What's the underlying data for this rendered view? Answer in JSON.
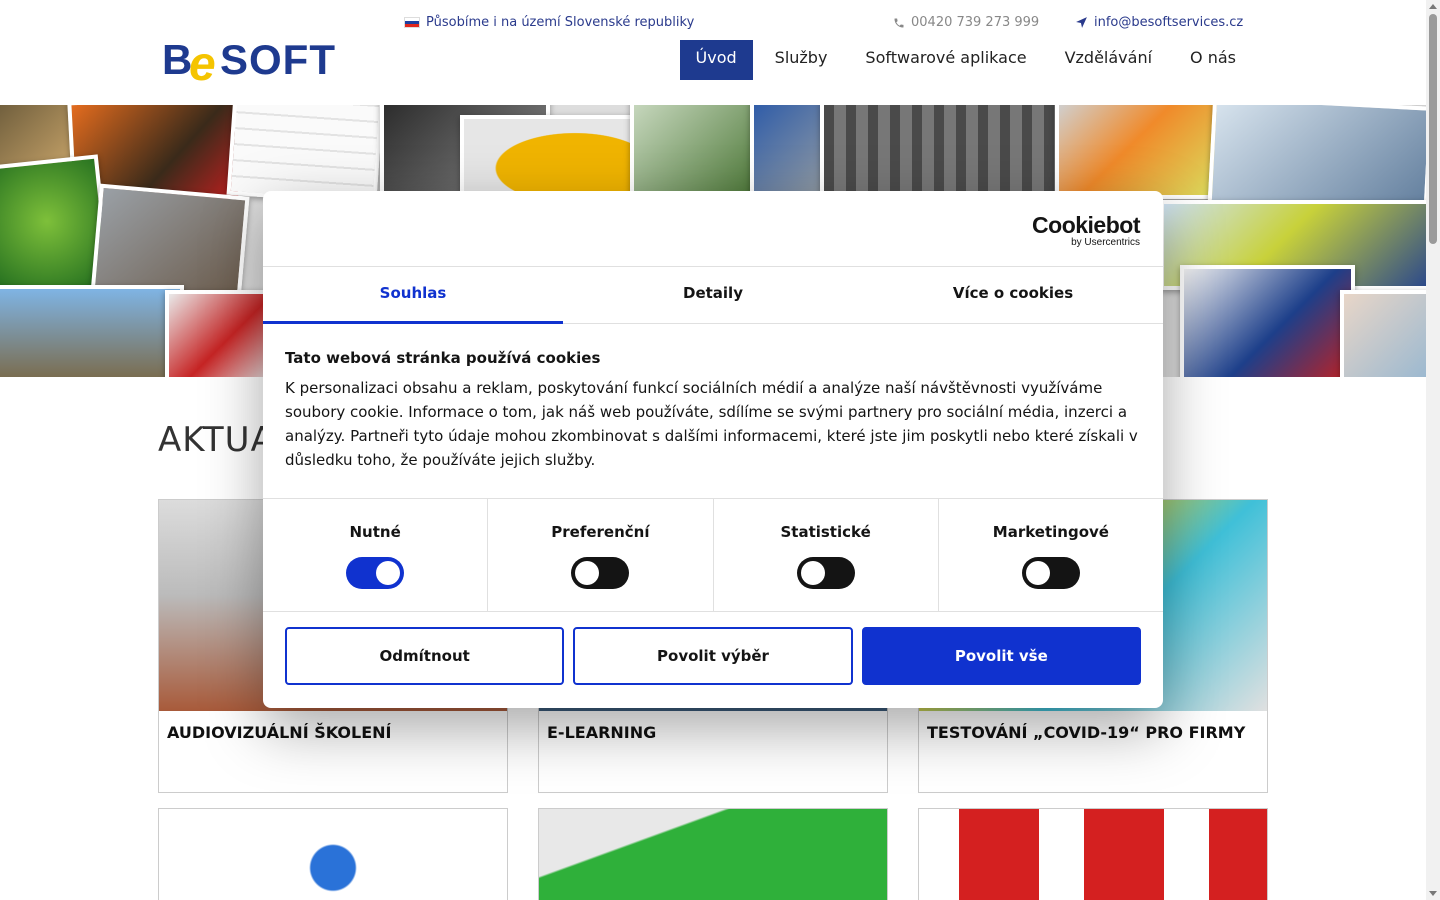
{
  "header": {
    "logo_text": "BeSOFT",
    "region_notice": "Působíme i na území Slovenské republiky",
    "phone": "00420 739 273 999",
    "email": "info@besoftservices.cz",
    "nav": [
      {
        "label": "Úvod",
        "active": true
      },
      {
        "label": "Služby",
        "active": false
      },
      {
        "label": "Softwarové aplikace",
        "active": false
      },
      {
        "label": "Vzdělávání",
        "active": false
      },
      {
        "label": "O nás",
        "active": false
      }
    ]
  },
  "main": {
    "section_title": "AKTUA",
    "cards": [
      {
        "title": "AUDIOVIZUÁLNÍ ŠKOLENÍ"
      },
      {
        "title": "E-LEARNING"
      },
      {
        "title": "TESTOVÁNÍ „COVID-19“ PRO FIRMY"
      }
    ]
  },
  "cookie_dialog": {
    "brand": "Cookiebot",
    "brand_sub": "by Usercentrics",
    "tabs": [
      {
        "label": "Souhlas",
        "active": true
      },
      {
        "label": "Detaily",
        "active": false
      },
      {
        "label": "Více o cookies",
        "active": false
      }
    ],
    "heading": "Tato webová stránka používá cookies",
    "body": "K personalizaci obsahu a reklam, poskytování funkcí sociálních médií a analýze naší návštěvnosti využíváme soubory cookie. Informace o tom, jak náš web používáte, sdílíme se svými partnery pro sociální média, inzerci a analýzy. Partneři tyto údaje mohou zkombinovat s dalšími informacemi, které jste jim poskytli nebo které získali v důsledku toho, že používáte jejich služby.",
    "categories": [
      {
        "label": "Nutné",
        "checked": true
      },
      {
        "label": "Preferenční",
        "checked": false
      },
      {
        "label": "Statistické",
        "checked": false
      },
      {
        "label": "Marketingové",
        "checked": false
      }
    ],
    "buttons": {
      "deny": "Odmítnout",
      "allow_selection": "Povolit výběr",
      "allow_all": "Povolit vše"
    }
  },
  "colors": {
    "brand_blue": "#1e3a8f",
    "cookie_accent": "#1032cf",
    "logo_yellow": "#f5c400"
  }
}
